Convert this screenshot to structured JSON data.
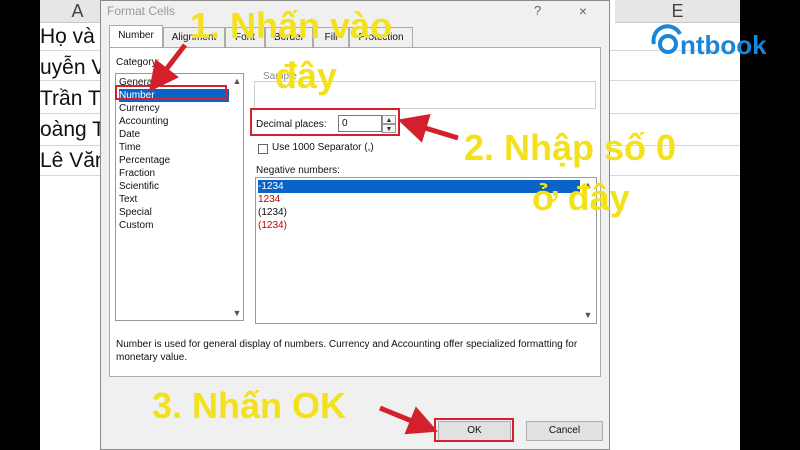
{
  "sheet": {
    "columns": [
      "A",
      "E"
    ],
    "names": [
      "Họ và T",
      "uyễn V",
      "Trần Th",
      "oàng T",
      "Lê Văn"
    ]
  },
  "dialog": {
    "title": "Format Cells",
    "help": "?",
    "close": "×",
    "tabs": [
      "Number",
      "Alignment",
      "Font",
      "Border",
      "Fill",
      "Protection"
    ],
    "category_label": "Category:",
    "categories": [
      "General",
      "Number",
      "Currency",
      "Accounting",
      "Date",
      "Time",
      "Percentage",
      "Fraction",
      "Scientific",
      "Text",
      "Special",
      "Custom"
    ],
    "selected_category": "Number",
    "sample_label": "Sample",
    "decimal_places_label": "Decimal places:",
    "decimal_places_value": "0",
    "separator_label": "Use 1000 Separator (,)",
    "negative_label": "Negative numbers:",
    "negative_options": [
      {
        "text": "-1234",
        "color": "#ffffff"
      },
      {
        "text": "1234",
        "color": "#c00000"
      },
      {
        "text": "(1234)",
        "color": "#111111"
      },
      {
        "text": "(1234)",
        "color": "#c00000"
      }
    ],
    "description": "Number is used for general display of numbers.  Currency and Accounting offer specialized formatting for monetary value.",
    "ok_label": "OK",
    "cancel_label": "Cancel"
  },
  "annotations": {
    "step1_line1": "1. Nhấn vào",
    "step1_line2": "đây",
    "step2_line1": "2. Nhập số 0",
    "step2_line2": "ở đây",
    "step3": "3. Nhấn OK",
    "color": "#f2e11b",
    "highlight_color": "#d4202c"
  },
  "logo": {
    "text": "ntbook"
  }
}
